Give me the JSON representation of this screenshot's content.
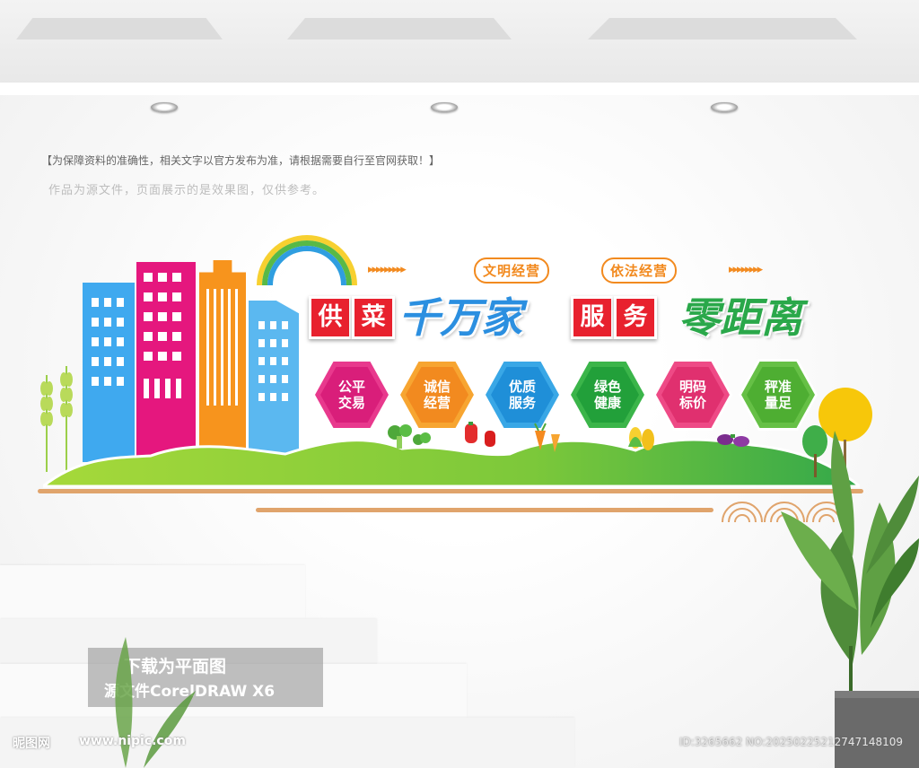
{
  "notice": {
    "line1": "【为保障资料的准确性，相关文字以官方发布为准，请根据需要自行至官网获取！】",
    "line2": "作品为源文件，页面展示的是效果图，仅供参考。"
  },
  "board": {
    "slogans": [
      "文明经营",
      "依法经营"
    ],
    "title_block1": [
      "供",
      "菜"
    ],
    "title_script1": "千万家",
    "title_block2": [
      "服",
      "务"
    ],
    "title_script2": "零距离",
    "badges": [
      {
        "line1": "公平",
        "line2": "交易",
        "color": "#e8398d",
        "inner": "#d91e7a"
      },
      {
        "line1": "诚信",
        "line2": "经营",
        "color": "#f7a531",
        "inner": "#f28a1f"
      },
      {
        "line1": "优质",
        "line2": "服务",
        "color": "#39a7e6",
        "inner": "#1f8fd8"
      },
      {
        "line1": "绿色",
        "line2": "健康",
        "color": "#3bb54a",
        "inner": "#22a03a"
      },
      {
        "line1": "明码",
        "line2": "标价",
        "color": "#ee4a86",
        "inner": "#e0306f"
      },
      {
        "line1": "秤准",
        "line2": "量足",
        "color": "#66c046",
        "inner": "#4eae32"
      }
    ]
  },
  "watermark": {
    "line1": "下载为平面图",
    "line2": "源文件CorelDRAW X6"
  },
  "footer": {
    "site_cn": "昵图网",
    "site_url": "www.nipic.com",
    "id_text": "ID:3265662 NO:20250225212747148109"
  },
  "colors": {
    "orange": "#f28a1f",
    "red": "#e8212e",
    "blue_script": "#2b8fe0",
    "green_script": "#2aa84a",
    "hill_green": "#8dd13a"
  }
}
